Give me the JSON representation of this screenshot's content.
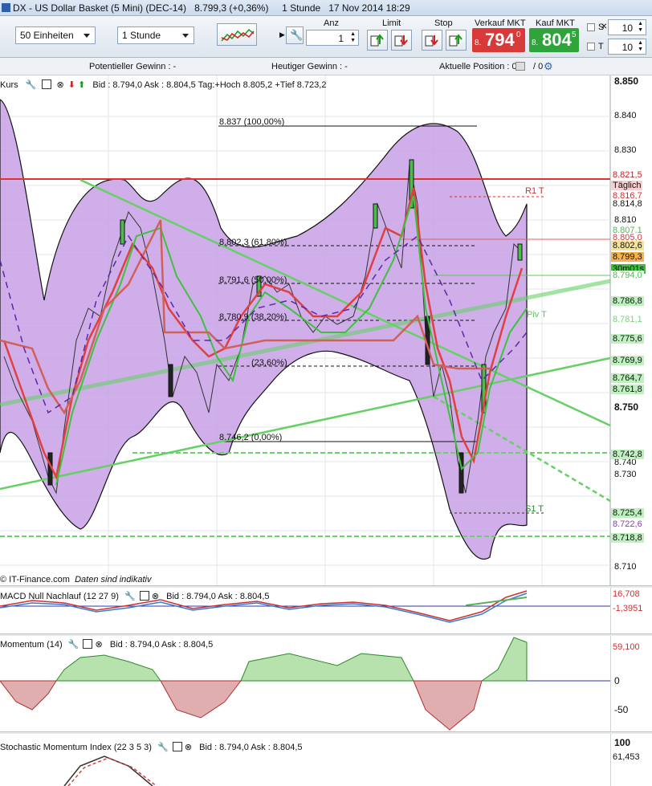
{
  "window": {
    "title": "DX - US Dollar Basket (5 Mini) (DEC-14)",
    "price": "8.799,3 (+0,36%)",
    "interval": "1 Stunde",
    "datetime": "17 Nov 2014 18:29"
  },
  "toolbar": {
    "units": "50 Einheiten",
    "period": "1 Stunde",
    "anz_label": "Anz",
    "anz_value": "1",
    "limit_label": "Limit",
    "stop_label": "Stop",
    "sell_label": "Verkauf MKT",
    "buy_label": "Kauf MKT",
    "sell_big": "794",
    "sell_prefix": "8.",
    "sell_sup": "0",
    "buy_big": "804",
    "buy_prefix": "8.",
    "buy_sup": "5",
    "s_label": "S",
    "s_value": "10",
    "t_label": "T",
    "t_value": "10"
  },
  "info": {
    "pot_gain": "Potentieller Gewinn : -",
    "today_gain": "Heutiger Gewinn : -",
    "position": "Aktuelle Position : 0",
    "position2": "/ 0"
  },
  "main_panel": {
    "header": "Kurs",
    "bidask": "Bid : 8.794,0 Ask : 8.804,5 Tag:+Hoch 8.805,2 +Tief 8.723,2",
    "footer": "© IT-Finance.com",
    "footer_note": "Daten sind indikativ",
    "fib": [
      "8.837 (100,00%)",
      "8.802,3 (61,80%)",
      "8.791,6 (50,00%)",
      "8.780,9 (38,20%)",
      "(23,60%)",
      "8.746,2 (0,00%)"
    ],
    "levels": [
      "R1 T",
      "Piv T",
      "S1 T"
    ]
  },
  "axis_main": [
    "8.850",
    "8.840",
    "8.830",
    "8.810",
    "8.750",
    "8.740",
    "8.730",
    "8.710"
  ],
  "tags": [
    {
      "text": "8.821,5",
      "bg": "#ffffff",
      "fg": "#c82020"
    },
    {
      "text": "Täglich",
      "bg": "#f8d0d0",
      "fg": "#111111"
    },
    {
      "text": "8.816,7",
      "bg": "#ffffff",
      "fg": "#d03030"
    },
    {
      "text": "8.814,8",
      "bg": "#ffffff",
      "fg": "#111111"
    },
    {
      "text": "8.807,1",
      "bg": "#ffffff",
      "fg": "#4cbc4c"
    },
    {
      "text": "8.805,0",
      "bg": "#ffffff",
      "fg": "#d04040"
    },
    {
      "text": "8.802,6",
      "bg": "#f6e39a",
      "fg": "#111111"
    },
    {
      "text": "8.799,3",
      "bg": "#f6b24a",
      "fg": "#111111"
    },
    {
      "text": "30m01s",
      "bg": "#3cbf3c",
      "fg": "#111111"
    },
    {
      "text": "8.794,0",
      "bg": "#ffffff",
      "fg": "#4cbc4c"
    },
    {
      "text": "8.786,8",
      "bg": "#bff0bf",
      "fg": "#111111"
    },
    {
      "text": "8.781,1",
      "bg": "#ffffff",
      "fg": "#7ad07a"
    },
    {
      "text": "8.775,6",
      "bg": "#bff0bf",
      "fg": "#111111"
    },
    {
      "text": "8.769,9",
      "bg": "#bff0bf",
      "fg": "#111111"
    },
    {
      "text": "8.764,7",
      "bg": "#bff0bf",
      "fg": "#111111"
    },
    {
      "text": "8.761,8",
      "bg": "#bff0bf",
      "fg": "#111111"
    },
    {
      "text": "8.742,8",
      "bg": "#bff0bf",
      "fg": "#111111"
    },
    {
      "text": "8.725,4",
      "bg": "#bff0bf",
      "fg": "#111111"
    },
    {
      "text": "8.722,6",
      "bg": "#ffffff",
      "fg": "#8a3cc0"
    },
    {
      "text": "8.718,8",
      "bg": "#bff0bf",
      "fg": "#111111"
    }
  ],
  "macd": {
    "header": "MACD Null Nachlauf (12 27 9)",
    "bidask": "Bid : 8.794,0 Ask : 8.804,5",
    "v1": "16,708",
    "v2": "-1,3951"
  },
  "momentum": {
    "header": "Momentum (14)",
    "bidask": "Bid : 8.794,0 Ask : 8.804,5",
    "value": "59,100",
    "zero": "0",
    "minus50": "-50"
  },
  "smi": {
    "header": "Stochastic Momentum Index (22 3 5 3)",
    "bidask": "Bid : 8.794,0 Ask : 8.804,5",
    "top": "100",
    "value": "61,453"
  }
}
